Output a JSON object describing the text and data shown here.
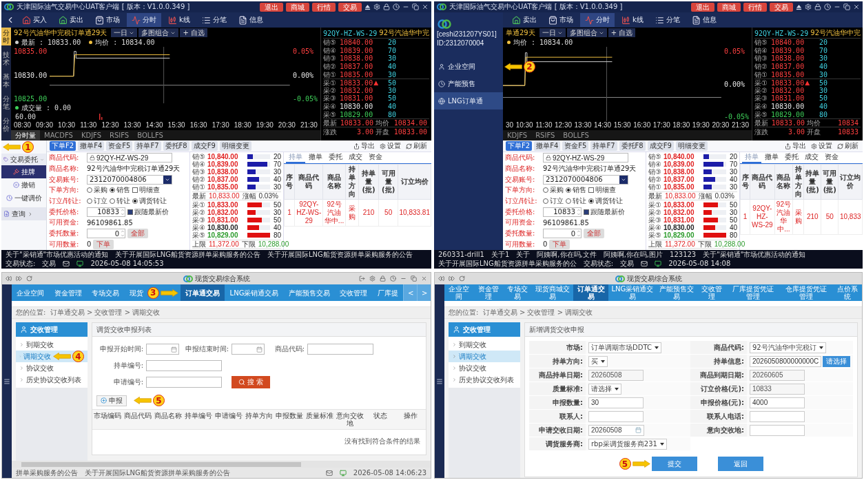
{
  "panels": [
    {
      "kind": "trading",
      "title": "天津国际油气交易中心UAT客户端 [ 版本：V1.0.0.349 ]",
      "header_buttons": [
        "退出",
        "商城",
        "行情",
        "交易"
      ],
      "back_button": true,
      "toolbar": [
        {
          "kind": "buy",
          "label": "买入",
          "selected": false
        },
        {
          "kind": "sell",
          "label": "卖出",
          "selected": false
        },
        {
          "kind": "market",
          "label": "市场",
          "selected": false
        },
        {
          "kind": "timeshare",
          "label": "分时",
          "selected": true
        },
        {
          "kind": "kline",
          "label": "k线",
          "selected": false
        },
        {
          "kind": "ticks",
          "label": "分笔",
          "selected": false
        },
        {
          "kind": "info",
          "label": "信息",
          "selected": false
        }
      ],
      "side_tabs": [
        {
          "label": "分时",
          "selected": true
        },
        {
          "label": "技术",
          "selected": false
        },
        {
          "label": "基本",
          "selected": false
        },
        {
          "label": "分笔",
          "selected": false
        },
        {
          "label": "分价",
          "selected": false
        }
      ],
      "chart": {
        "product": "92号汽油华中完税订单通29天",
        "period": "一日",
        "layout": "多图组合",
        "watch": "+ 自选",
        "legend": [
          {
            "text": "最新 : 10833.00",
            "color": "#cccccc"
          },
          {
            "text": "均价 : 10834.00",
            "color": "#f0c040"
          }
        ],
        "prices": [
          "10835.00",
          "10830.00",
          "10825.00"
        ],
        "percents": [
          "0.05%",
          "0.00%",
          "-0.05%"
        ],
        "volume_label": "成交量 : 0.00",
        "volume_max": "60.00",
        "times": [
          "08:30",
          "09:30",
          "10:30",
          "11:30",
          "12:30",
          "13:30",
          "14:30",
          "15:30",
          "16:30",
          "17:30",
          "18:30",
          "19:30",
          "20:30",
          "21:30"
        ],
        "indicator_tabs": [
          {
            "label": "分时量",
            "selected": true
          },
          {
            "label": "MACDFS",
            "selected": false
          },
          {
            "label": "KDJFS",
            "selected": false
          },
          {
            "label": "RSIFS",
            "selected": false
          },
          {
            "label": "BOLLFS",
            "selected": false
          }
        ]
      },
      "book": {
        "code": "92QY-HZ-WS-29",
        "name": "92号汽油华中完",
        "rows": [
          {
            "label": "销⑤",
            "price": "10840.00",
            "qty": "20",
            "color": "#ff4040"
          },
          {
            "label": "销④",
            "price": "10839.00",
            "qty": "70",
            "color": "#ff4040"
          },
          {
            "label": "销③",
            "price": "10838.00",
            "qty": "30",
            "color": "#ff4040"
          },
          {
            "label": "销②",
            "price": "10837.00",
            "qty": "40",
            "color": "#ff4040"
          },
          {
            "label": "销①",
            "price": "10835.00",
            "qty": "30",
            "color": "#ff4040"
          },
          {
            "label": "采①",
            "price": "10833.00",
            "arrow": "▲",
            "qty": "50",
            "color": "#ff4040"
          },
          {
            "label": "采②",
            "price": "10832.00",
            "qty": "30",
            "color": "#ff4040"
          },
          {
            "label": "采③",
            "price": "10831.00",
            "qty": "50",
            "color": "#ff4040"
          },
          {
            "label": "采④",
            "price": "10830.00",
            "qty": "40",
            "color": "#e8e8e8"
          },
          {
            "label": "采⑤",
            "price": "10829.00",
            "qty": "80",
            "color": "#3fd05a"
          }
        ],
        "summary": [
          [
            "最新",
            "10833.00",
            "均价",
            "10834.00"
          ],
          [
            "涨跌",
            "3.00",
            "开盘",
            "10833.00"
          ]
        ]
      },
      "menu": {
        "annotation": {
          "number": "1",
          "kind": "left"
        },
        "group": "交易委托",
        "items": [
          {
            "label": "挂牌",
            "selected": true
          },
          {
            "label": "撤销",
            "selected": false
          },
          {
            "label": "一键调价",
            "selected": false
          }
        ],
        "query": "查询"
      },
      "func_tabs": [
        {
          "label": "下单F2",
          "selected": true
        },
        {
          "label": "撤单F4",
          "selected": false
        },
        {
          "label": "资金F5",
          "selected": false
        },
        {
          "label": "持单F7",
          "selected": false
        },
        {
          "label": "委托F8",
          "selected": false
        },
        {
          "label": "成交F9",
          "selected": false
        },
        {
          "label": "明细变更",
          "selected": false
        }
      ],
      "tools": [
        "导出",
        "设置",
        "刷新"
      ],
      "form": [
        {
          "kind": "locked",
          "label": "商品代码:",
          "value": "92QY-HZ-WS-29"
        },
        {
          "kind": "text",
          "label": "商品名称:",
          "value": "92号汽油华中完税订单通29天"
        },
        {
          "kind": "select",
          "label": "交易账号:",
          "value": "2312070004806"
        },
        {
          "kind": "radio",
          "label": "下单方向:",
          "options": [
            {
              "label": "采购",
              "selected": false
            },
            {
              "label": "销售",
              "selected": true
            }
          ],
          "check": {
            "label": "明细查",
            "checked": false
          }
        },
        {
          "kind": "radio",
          "label": "订立/转让:",
          "options": [
            {
              "label": "订立",
              "selected": false
            },
            {
              "label": "转让",
              "selected": false
            },
            {
              "label": "调货转让",
              "selected": true
            }
          ]
        },
        {
          "kind": "spinner",
          "label": "委托价格:",
          "value": "10833",
          "check": {
            "label": "跟随最新价",
            "checked": true
          }
        },
        {
          "kind": "text",
          "label": "可用资金:",
          "value": "96109861.85"
        },
        {
          "kind": "spinner",
          "label": "委托数量:",
          "value": "0",
          "button": "全部"
        },
        {
          "kind": "text",
          "label": "可用数量:",
          "value": "0",
          "button": "下单"
        }
      ],
      "depth": {
        "sells": [
          {
            "label": "销⑤",
            "price": "10,840.00",
            "qty": "20",
            "level": 0.25,
            "color": "#e02020"
          },
          {
            "label": "销④",
            "price": "10,839.00",
            "qty": "70",
            "level": 0.875,
            "color": "#e02020"
          },
          {
            "label": "销③",
            "price": "10,838.00",
            "qty": "30",
            "level": 0.375,
            "color": "#e02020"
          },
          {
            "label": "销②",
            "price": "10,837.00",
            "qty": "40",
            "level": 0.5,
            "color": "#e02020"
          },
          {
            "label": "销①",
            "price": "10,835.00",
            "qty": "30",
            "level": 0.375,
            "color": "#e02020"
          }
        ],
        "last": [
          "最新",
          "10,833.00",
          "涨幅",
          "0.03%"
        ],
        "buys": [
          {
            "label": "采①",
            "price": "10,833.00",
            "qty": "50",
            "level": 0.625,
            "color": "#e02020"
          },
          {
            "label": "采②",
            "price": "10,832.00",
            "qty": "30",
            "level": 0.375,
            "color": "#e02020"
          },
          {
            "label": "采③",
            "price": "10,831.00",
            "qty": "50",
            "level": 0.625,
            "color": "#e02020"
          },
          {
            "label": "采④",
            "price": "10,830.00",
            "qty": "40",
            "level": 0.5,
            "color": "#222222"
          },
          {
            "label": "采⑤",
            "price": "10,829.00",
            "qty": "80",
            "level": 1,
            "color": "#2a9a2a"
          }
        ],
        "limits": [
          "上限",
          "11,372.00",
          "下限",
          "10,288.00"
        ]
      },
      "positions": {
        "tabs": [
          {
            "label": "持单",
            "selected": true
          },
          {
            "label": "撤单",
            "selected": false
          },
          {
            "label": "委托",
            "selected": false
          },
          {
            "label": "成交",
            "selected": false
          },
          {
            "label": "资金",
            "selected": false
          }
        ],
        "columns": [
          "序号",
          "商品代码",
          "商品名称",
          "持单方向",
          "持单量(批)",
          "可用量(批)",
          "订立均价"
        ],
        "rows": [
          [
            "1",
            "92QY-HZ-WS-29",
            "92号汽油华中...",
            "采购",
            "210",
            "50",
            "10,833.81"
          ]
        ]
      },
      "status": {
        "items": [
          "关于\"采销通\"市场优惠活动的通知",
          "关于开展国际LNG船货资源拼单采购服务的公告",
          "关于开展国际LNG船货资源拼单采购服务的公告"
        ],
        "state_label": "交易状态:",
        "state": "交易",
        "time": "2026-05-08 14:05:53"
      }
    },
    {
      "kind": "trading",
      "title": "天津国际油气交易中心UAT客户端 [ 版本：V1.0.0.349 ]",
      "header_buttons": [
        "退出",
        "商城",
        "行情",
        "交易"
      ],
      "nav": {
        "user": "[ceshi231207YS01]",
        "id": "ID:2312070004",
        "items": [
          {
            "label": "企业空间",
            "selected": false,
            "annotation": {
              "number": "2",
              "kind": "left"
            }
          },
          {
            "label": "产能预售",
            "selected": false
          },
          {
            "label": "LNG订单通",
            "selected": true
          }
        ]
      },
      "toolbar": [
        {
          "kind": "sell",
          "label": "卖出",
          "selected": false
        },
        {
          "kind": "market",
          "label": "市场",
          "selected": false
        },
        {
          "kind": "timeshare",
          "label": "分时",
          "selected": true
        },
        {
          "kind": "kline",
          "label": "k线",
          "selected": false
        },
        {
          "kind": "ticks",
          "label": "分笔",
          "selected": false
        },
        {
          "kind": "info",
          "label": "信息",
          "selected": false
        }
      ],
      "chart": {
        "product": "单通29天",
        "period": "一日",
        "layout": "多图组合",
        "watch": "+ 自选",
        "legend": [
          {
            "text": "均价 : 10834.00",
            "color": "#f0c040"
          }
        ],
        "percents": [
          "0.05%",
          "0.00%",
          "-0.05%"
        ],
        "times": [
          "30",
          "10:30",
          "11:30",
          "12:30",
          "13:30",
          "14:30",
          "15:30",
          "16:30",
          "17:30",
          "18:30",
          "19:30",
          "20:30",
          "21:30"
        ],
        "indicator_tabs": [
          {
            "label": "KDJFS",
            "selected": false
          },
          {
            "label": "RSIFS",
            "selected": false
          },
          {
            "label": "BOLLFS",
            "selected": false
          }
        ]
      },
      "book": {
        "code": "92QY-HZ-WS-29",
        "name": "92号汽油华中完",
        "rows": [
          {
            "label": "销⑤",
            "price": "10840.00",
            "qty": "20",
            "color": "#ff4040"
          },
          {
            "label": "销④",
            "price": "10839.00",
            "qty": "70",
            "color": "#ff4040"
          },
          {
            "label": "销③",
            "price": "10838.00",
            "qty": "30",
            "color": "#ff4040"
          },
          {
            "label": "销②",
            "price": "10837.00",
            "qty": "40",
            "color": "#ff4040"
          },
          {
            "label": "销①",
            "price": "10835.00",
            "qty": "30",
            "color": "#ff4040"
          },
          {
            "label": "采①",
            "price": "10833.00",
            "arrow": "▲",
            "qty": "50",
            "color": "#ff4040"
          },
          {
            "label": "采②",
            "price": "10832.00",
            "qty": "30",
            "color": "#ff4040"
          },
          {
            "label": "采③",
            "price": "10831.00",
            "qty": "50",
            "color": "#ff4040"
          },
          {
            "label": "采④",
            "price": "10830.00",
            "qty": "40",
            "color": "#e8e8e8"
          },
          {
            "label": "采⑤",
            "price": "10829.00",
            "qty": "80",
            "color": "#3fd05a"
          }
        ],
        "summary": [
          [
            "最新",
            "10833.00",
            "均价",
            "10834"
          ],
          [
            "涨跌",
            "3.00",
            "开盘",
            "10833"
          ]
        ]
      },
      "func_tabs": [
        {
          "label": "下单F2",
          "selected": true
        },
        {
          "label": "撤单F4",
          "selected": false
        },
        {
          "label": "资金F5",
          "selected": false
        },
        {
          "label": "持单F7",
          "selected": false
        },
        {
          "label": "委托F8",
          "selected": false
        },
        {
          "label": "成交F9",
          "selected": false
        },
        {
          "label": "明细变更",
          "selected": false
        }
      ],
      "tools": [
        "导出",
        "设置",
        "刷新"
      ],
      "form": [
        {
          "kind": "locked",
          "label": "商品代码:",
          "value": "92QY-HZ-WS-29"
        },
        {
          "kind": "text",
          "label": "商品名称:",
          "value": "92号汽油华中完税订单通29天"
        },
        {
          "kind": "select",
          "label": "交易账号:",
          "value": "2312070004806"
        },
        {
          "kind": "radio",
          "label": "下单方向:",
          "options": [
            {
              "label": "采购",
              "selected": false
            },
            {
              "label": "销售",
              "selected": true
            }
          ],
          "check": {
            "label": "明细查",
            "checked": false
          }
        },
        {
          "kind": "radio",
          "label": "订立/转让:",
          "options": [
            {
              "label": "订立",
              "selected": false
            },
            {
              "label": "转让",
              "selected": false
            },
            {
              "label": "调货转让",
              "selected": true
            }
          ]
        },
        {
          "kind": "spinner",
          "label": "委托价格:",
          "value": "10833",
          "check": {
            "label": "跟随最新价",
            "checked": true
          }
        },
        {
          "kind": "text",
          "label": "可用资金:",
          "value": "96109861.85"
        },
        {
          "kind": "spinner",
          "label": "委托数量:",
          "value": "0",
          "button": "全部"
        },
        {
          "kind": "text",
          "label": "可用数量:",
          "value": "0",
          "button": "下单"
        }
      ],
      "depth": {
        "sells": [
          {
            "label": "销⑤",
            "price": "10,840.00",
            "qty": "20",
            "level": 0.25,
            "color": "#e02020"
          },
          {
            "label": "销④",
            "price": "10,839.00",
            "qty": "70",
            "level": 0.875,
            "color": "#e02020"
          },
          {
            "label": "销③",
            "price": "10,838.00",
            "qty": "30",
            "level": 0.375,
            "color": "#e02020"
          },
          {
            "label": "销②",
            "price": "10,837.00",
            "qty": "40",
            "level": 0.5,
            "color": "#e02020"
          },
          {
            "label": "销①",
            "price": "10,835.00",
            "qty": "30",
            "level": 0.375,
            "color": "#e02020"
          }
        ],
        "last": [
          "最新",
          "10,833.00",
          "涨幅",
          "0.03%"
        ],
        "buys": [
          {
            "label": "采①",
            "price": "10,833.00",
            "qty": "50",
            "level": 0.625,
            "color": "#e02020"
          },
          {
            "label": "采②",
            "price": "10,832.00",
            "qty": "30",
            "level": 0.375,
            "color": "#e02020"
          },
          {
            "label": "采③",
            "price": "10,831.00",
            "qty": "50",
            "level": 0.625,
            "color": "#e02020"
          },
          {
            "label": "采④",
            "price": "10,830.00",
            "qty": "40",
            "level": 0.5,
            "color": "#222222"
          },
          {
            "label": "采⑤",
            "price": "10,829.00",
            "qty": "80",
            "level": 1,
            "color": "#2a9a2a"
          }
        ],
        "limits": [
          "上限",
          "11,372.00",
          "下限",
          "10,288.00"
        ]
      },
      "positions": {
        "tabs": [
          {
            "label": "持单",
            "selected": true
          },
          {
            "label": "撤单",
            "selected": false
          },
          {
            "label": "委托",
            "selected": false
          },
          {
            "label": "成交",
            "selected": false
          },
          {
            "label": "资金",
            "selected": false
          }
        ],
        "columns": [
          "序号",
          "商品代码",
          "商品名称",
          "持单方向",
          "持单量(批)",
          "可用量(批)",
          "订立均价"
        ],
        "rows": [
          [
            "1",
            "92QY-HZ-WS-29",
            "92号汽油华中...",
            "采购",
            "210",
            "50",
            "10,833"
          ]
        ]
      },
      "status": {
        "items": [
          "260331-drill1",
          "关于1",
          "关于",
          "阿姨啊,你在吗,文件",
          "阿姨啊,你在吗,图片",
          "123123",
          "关于\"采销通\"市场优惠活动的通知",
          "关于开展国际LNG船货资源拼单采购服务的公"
        ],
        "state_label": "交易状态:",
        "state": "交易",
        "time": "2026-05-08 14:08"
      }
    },
    {
      "kind": "web_list",
      "title": "现货交易综合系统",
      "window_controls": true,
      "nav": [
        {
          "label": "企业空间",
          "selected": false
        },
        {
          "label": "资金管理",
          "selected": false
        },
        {
          "label": "专场交易",
          "selected": false
        },
        {
          "label": "现货",
          "selected": false,
          "annotation": {
            "number": "3",
            "kind": "right"
          }
        },
        {
          "label": "订单通交易",
          "selected": true
        },
        {
          "label": "LNG采销通交易",
          "selected": false
        },
        {
          "label": "产能预售交易",
          "selected": false
        },
        {
          "label": "交收管理",
          "selected": false
        },
        {
          "label": "厂库提",
          "selected": false
        }
      ],
      "nav_arrows": [
        "<",
        ">"
      ],
      "breadcrumb": "您的位置:  订单通交易 > 交收管理 > 调期交收",
      "side": {
        "title": "交收管理",
        "items": [
          {
            "label": "到期交收",
            "selected": false
          },
          {
            "label": "调期交收",
            "selected": true,
            "annotation": {
              "number": "4",
              "kind": "left"
            }
          },
          {
            "label": "协议交收",
            "selected": false
          },
          {
            "label": "历史协议交收列表",
            "selected": false
          }
        ]
      },
      "list": {
        "title": "调货交收申报列表",
        "filters": [
          {
            "kind": "date",
            "label": "申报开始时间:"
          },
          {
            "kind": "date",
            "label": "申报结束时间:"
          },
          {
            "kind": "text",
            "label": "商品代码:"
          },
          {
            "kind": "text",
            "label": "持单编号:"
          },
          {
            "kind": "text",
            "label": "申请编号:"
          }
        ],
        "search": "搜 索",
        "add": {
          "label": "申报",
          "annotation": {
            "number": "5",
            "kind": "left"
          }
        },
        "columns": [
          "市场编码",
          "商品代码",
          "商品名称",
          "持单编号",
          "申请编号",
          "持单方向",
          "申报数量",
          "质量标准",
          "意向交收地",
          "状态",
          "操作"
        ],
        "empty": "没有找到符合条件的结果"
      },
      "status": {
        "items": [
          "拼单采购服务的公告",
          "关于开展国际LNG船货资源拼单采购服务的公告"
        ],
        "time": "2026-05-08 14:06:23"
      }
    },
    {
      "kind": "web_form",
      "title": "现货交易综合系统",
      "nav": [
        {
          "label": "企业空间",
          "selected": false
        },
        {
          "label": "资金管理",
          "selected": false
        },
        {
          "label": "专场交易",
          "selected": false
        },
        {
          "label": "现货商城交易",
          "selected": false
        },
        {
          "label": "订单通交易",
          "selected": true
        },
        {
          "label": "LNG采销通交易",
          "selected": false
        },
        {
          "label": "产能预售交易",
          "selected": false
        },
        {
          "label": "交收管理",
          "selected": false
        },
        {
          "label": "厂库提货凭证管理",
          "selected": false
        },
        {
          "label": "仓库提货凭证管理",
          "selected": false
        },
        {
          "label": "点价系统",
          "selected": false
        }
      ],
      "breadcrumb": "您的位置:  订单通交易 > 交收管理 > 调期交收",
      "side": {
        "title": "交收管理",
        "items": [
          {
            "label": "到期交收",
            "selected": false
          },
          {
            "label": "调期交收",
            "selected": true
          },
          {
            "label": "协议交收",
            "selected": false
          },
          {
            "label": "历史协议交收列表",
            "selected": false
          }
        ]
      },
      "form": {
        "title": "新增调货交收申报",
        "fields": [
          {
            "kind": "select",
            "label": "市场:",
            "value": "订单调期市场DDTC"
          },
          {
            "kind": "select",
            "label": "商品代码:",
            "value": "92号汽油华中完税订"
          },
          {
            "kind": "select",
            "label": "持单方向:",
            "value": "买"
          },
          {
            "kind": "picker",
            "label": "持单信息:",
            "value": "2026050800000000C",
            "button": "请选择"
          },
          {
            "kind": "readonly",
            "label": "商品持单日期:",
            "value": "20260508"
          },
          {
            "kind": "readonly",
            "label": "商品到期日期:",
            "value": "20260605"
          },
          {
            "kind": "select",
            "label": "质量标准:",
            "value": "请选择"
          },
          {
            "kind": "readonly",
            "label": "订立价格(元):",
            "value": "10833"
          },
          {
            "kind": "input",
            "label": "申报数量:",
            "value": "30"
          },
          {
            "kind": "input",
            "label": "申报价格(元):",
            "value": "4000"
          },
          {
            "kind": "input",
            "label": "联系人:"
          },
          {
            "kind": "input",
            "label": "联系人电话:"
          },
          {
            "kind": "date",
            "label": "申请交收日期:",
            "value": "20260508"
          },
          {
            "kind": "input",
            "label": "意向交收地:"
          },
          {
            "kind": "select",
            "label": "调货服务商:",
            "value": "rbp采调货服务商231"
          }
        ],
        "submit": {
          "label": "提交",
          "annotation": {
            "number": "5",
            "kind": "right"
          }
        },
        "back": "返回"
      }
    }
  ]
}
